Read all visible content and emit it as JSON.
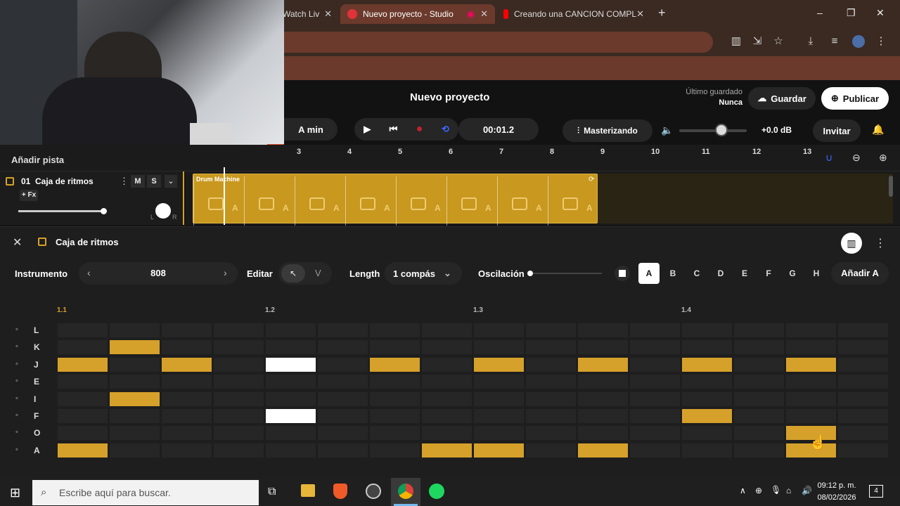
{
  "browser": {
    "tabs": [
      {
        "label": "Watch Liv",
        "active": false
      },
      {
        "label": "Nuevo proyecto - Studio",
        "active": true
      },
      {
        "label": "Creando una CANCION COMPL",
        "active": false
      }
    ],
    "new_tab": "+",
    "window_controls": [
      "–",
      "❐",
      "✕"
    ]
  },
  "app": {
    "project_title": "Nuevo proyecto",
    "last_saved_label": "Último guardado",
    "last_saved_value": "Nunca",
    "save_label": "Guardar",
    "publish_label": "Publicar",
    "key_label": "A min",
    "time": "00:01.2",
    "mastering_label": "Masterizando",
    "volume_db": "+0.0 dB",
    "invite_label": "Invitar",
    "add_track_label": "Añadir pista"
  },
  "ruler": {
    "numbers": [
      "3",
      "4",
      "5",
      "6",
      "7",
      "8",
      "9",
      "10",
      "11",
      "12",
      "13"
    ]
  },
  "track": {
    "number": "01",
    "name": "Caja de ritmos",
    "mute": "M",
    "solo": "S",
    "fx": "+ Fx",
    "pan_left": "L",
    "pan_right": "R",
    "clip_label": "Drum Machine",
    "clip_pattern": "A"
  },
  "drum_panel": {
    "title": "Caja de ritmos",
    "instrument_label": "Instrumento",
    "instrument_value": "808",
    "edit_label": "Editar",
    "edit_alt": "V",
    "length_label": "Length",
    "length_value": "1 compás",
    "swing_label": "Oscilación",
    "patterns": [
      "A",
      "B",
      "C",
      "D",
      "E",
      "F",
      "G",
      "H"
    ],
    "add_pattern_label": "Añadir A",
    "beats": [
      "1.1",
      "1.2",
      "1.3",
      "1.4"
    ],
    "rows": [
      {
        "key": "L",
        "steps": [
          0,
          0,
          0,
          0,
          0,
          0,
          0,
          0,
          0,
          0,
          0,
          0,
          0,
          0,
          0,
          0
        ]
      },
      {
        "key": "K",
        "steps": [
          0,
          1,
          0,
          0,
          0,
          0,
          0,
          0,
          0,
          0,
          0,
          0,
          0,
          0,
          0,
          0
        ]
      },
      {
        "key": "J",
        "steps": [
          1,
          0,
          1,
          0,
          2,
          0,
          1,
          0,
          1,
          0,
          1,
          0,
          1,
          0,
          1,
          0
        ]
      },
      {
        "key": "E",
        "steps": [
          0,
          0,
          0,
          0,
          0,
          0,
          0,
          0,
          0,
          0,
          0,
          0,
          0,
          0,
          0,
          0
        ]
      },
      {
        "key": "I",
        "steps": [
          0,
          1,
          0,
          0,
          0,
          0,
          0,
          0,
          0,
          0,
          0,
          0,
          0,
          0,
          0,
          0
        ]
      },
      {
        "key": "F",
        "steps": [
          0,
          0,
          0,
          0,
          2,
          0,
          0,
          0,
          0,
          0,
          0,
          0,
          1,
          0,
          0,
          0
        ]
      },
      {
        "key": "O",
        "steps": [
          0,
          0,
          0,
          0,
          0,
          0,
          0,
          0,
          0,
          0,
          0,
          0,
          0,
          0,
          1,
          0
        ]
      },
      {
        "key": "A",
        "steps": [
          1,
          0,
          0,
          0,
          0,
          0,
          0,
          1,
          1,
          0,
          1,
          0,
          0,
          0,
          1,
          0
        ]
      }
    ]
  },
  "taskbar": {
    "search_placeholder": "Escribe aquí para buscar.",
    "time": "09:12 p. m.",
    "date": "08/02/2026",
    "notifications": "4"
  },
  "colors": {
    "accent": "#d6a12a",
    "tab_active": "#6b3a2c",
    "chrome": "#3a2a22",
    "record": "#c0232b",
    "loop": "#3b66ff"
  }
}
